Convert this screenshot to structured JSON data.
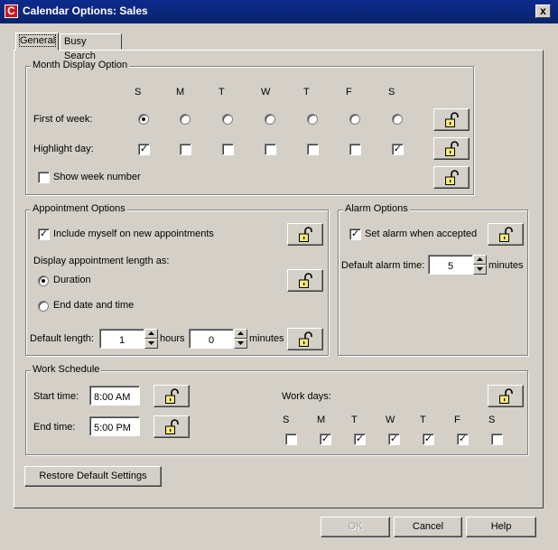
{
  "window": {
    "title": "Calendar Options: Sales",
    "close_glyph": "x"
  },
  "tabs": [
    {
      "label": "General",
      "selected": true
    },
    {
      "label": "Busy Search",
      "selected": false
    }
  ],
  "month_display": {
    "legend": "Month Display Option",
    "days": [
      "S",
      "M",
      "T",
      "W",
      "T",
      "F",
      "S"
    ],
    "first_of_week_label": "First of week:",
    "first_of_week_selected_index": 0,
    "highlight_day_label": "Highlight day:",
    "highlight_days_checked": [
      true,
      false,
      false,
      false,
      false,
      false,
      true
    ],
    "show_week_number_label": "Show week number",
    "show_week_number_checked": false
  },
  "appointment": {
    "legend": "Appointment Options",
    "include_myself_label": "Include myself on new appointments",
    "include_myself_checked": true,
    "display_length_label": "Display appointment length as:",
    "duration_label": "Duration",
    "end_date_label": "End date and time",
    "selected_option": "duration",
    "default_length_label": "Default length:",
    "hours_value": "1",
    "hours_label": "hours",
    "minutes_value": "0",
    "minutes_label": "minutes"
  },
  "alarm": {
    "legend": "Alarm Options",
    "set_alarm_label": "Set alarm when accepted",
    "set_alarm_checked": true,
    "default_time_label": "Default alarm time:",
    "default_time_value": "5",
    "minutes_label": "minutes"
  },
  "work_schedule": {
    "legend": "Work Schedule",
    "start_label": "Start time:",
    "start_value": "8:00 AM",
    "end_label": "End time:",
    "end_value": "5:00 PM",
    "work_days_label": "Work days:",
    "days": [
      "S",
      "M",
      "T",
      "W",
      "T",
      "F",
      "S"
    ],
    "work_days_checked": [
      false,
      true,
      true,
      true,
      true,
      true,
      false
    ]
  },
  "buttons": {
    "restore": "Restore Default Settings",
    "ok": "OK",
    "cancel": "Cancel",
    "help": "Help"
  },
  "icons": {
    "lock": "unlocked-padlock-icon",
    "app": "calendar-app-icon"
  },
  "colors": {
    "titlebar": "#0a246a",
    "face": "#d4d0c8",
    "lock_body": "#f5e87a"
  }
}
